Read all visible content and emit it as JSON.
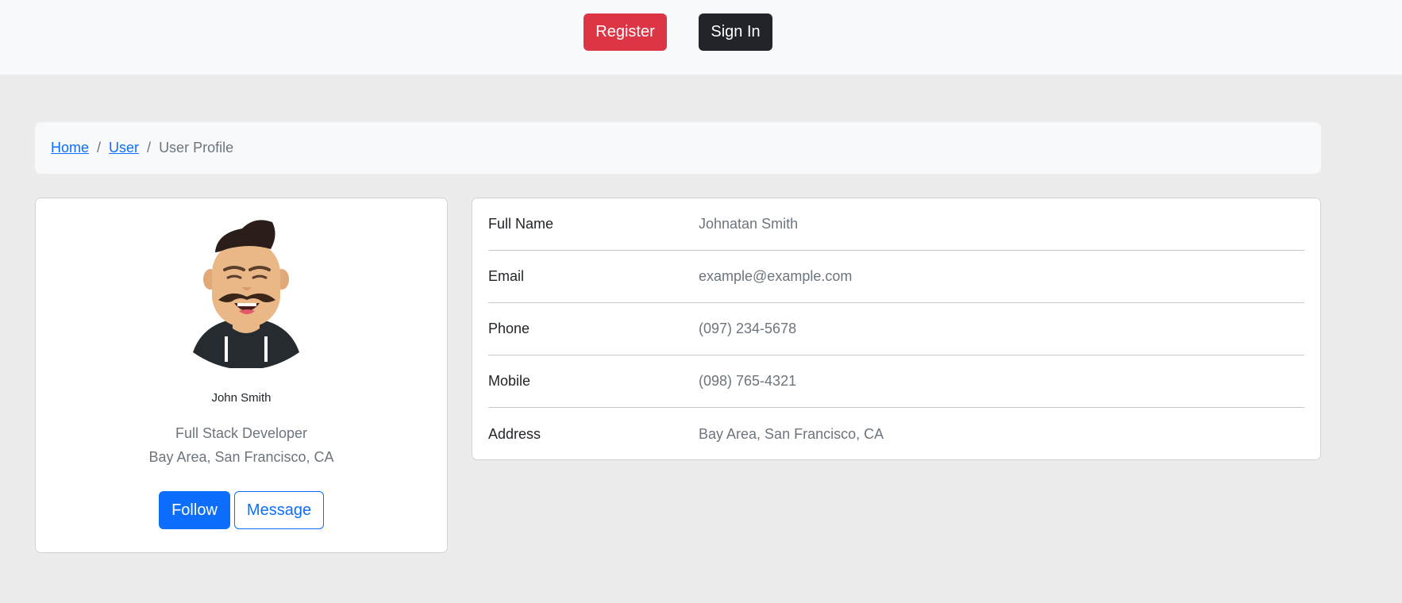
{
  "header": {
    "register_label": "Register",
    "signin_label": "Sign In"
  },
  "breadcrumb": {
    "home": "Home",
    "user": "User",
    "current": "User Profile",
    "separator": "/"
  },
  "profile": {
    "name": "John Smith",
    "title": "Full Stack Developer",
    "location": "Bay Area, San Francisco, CA",
    "follow_label": "Follow",
    "message_label": "Message",
    "avatar_icon": "avatar-illustration"
  },
  "details": [
    {
      "label": "Full Name",
      "value": "Johnatan Smith"
    },
    {
      "label": "Email",
      "value": "example@example.com"
    },
    {
      "label": "Phone",
      "value": "(097) 234-5678"
    },
    {
      "label": "Mobile",
      "value": "(098) 765-4321"
    },
    {
      "label": "Address",
      "value": "Bay Area, San Francisco, CA"
    }
  ],
  "colors": {
    "primary": "#0d6efd",
    "danger": "#dc3545",
    "dark": "#212529",
    "muted": "#6c757d",
    "background": "#ececec"
  }
}
